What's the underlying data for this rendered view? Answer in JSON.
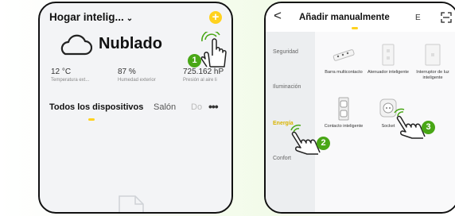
{
  "colors": {
    "accent_yellow": "#ffd21f",
    "step_green": "#49a716",
    "active_category": "#d9b400"
  },
  "left_screen": {
    "home_title": "Hogar intelig...",
    "home_chevron": "⌄",
    "add_button_icon": "+",
    "weather": {
      "icon": "cloud-icon",
      "condition": "Nublado"
    },
    "stats": [
      {
        "value": "12 °C",
        "label": "Temperatura ext..."
      },
      {
        "value": "87 %",
        "label": "Humedad exterior"
      },
      {
        "value": "725.162 hP",
        "label": "Presión al aire li"
      }
    ],
    "tabs": [
      {
        "label": "Todos los dispositivos",
        "active": true
      },
      {
        "label": "Salón",
        "active": false
      },
      {
        "label": "Do",
        "active": false
      }
    ],
    "more_icon": "•••",
    "step_badge": "1"
  },
  "right_screen": {
    "back_icon": "<",
    "title": "Añadir manualmente",
    "next_tab_fragment": "E",
    "scan_icon": "scan-icon",
    "categories": [
      {
        "label": "Seguridad",
        "active": false
      },
      {
        "label": "Iluminación",
        "active": false
      },
      {
        "label": "Energía",
        "active": true
      },
      {
        "label": "Confort",
        "active": false
      }
    ],
    "devices": [
      {
        "label": "Barra multicontacto"
      },
      {
        "label": "Atenuador inteligente"
      },
      {
        "label": "Interruptor de luz inteligente"
      },
      {
        "label": "Contacto inteligente"
      },
      {
        "label": "Socket"
      }
    ],
    "step_badges": [
      "2",
      "3"
    ]
  }
}
